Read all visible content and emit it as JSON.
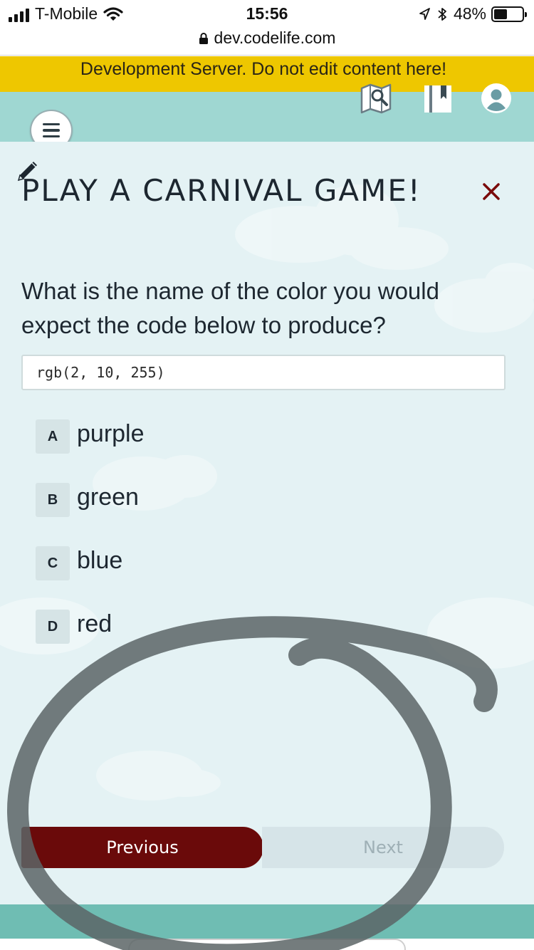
{
  "status_bar": {
    "carrier": "T-Mobile",
    "time": "15:56",
    "battery_percent": "48%",
    "battery_level": 0.48,
    "url": "dev.codelife.com"
  },
  "dev_banner": {
    "text": "Development Server. Do not edit content here!"
  },
  "header": {
    "icons": [
      "map-icon",
      "book-icon",
      "user-icon"
    ],
    "menu_icon": "hamburger-menu-icon"
  },
  "page": {
    "title": "PLAY A CARNIVAL GAME!",
    "close_symbol": "✕",
    "question": "What is the name of the color you would expect the code below to produce?",
    "code": "rgb(2, 10, 255)",
    "options": [
      {
        "letter": "A",
        "text": "purple"
      },
      {
        "letter": "B",
        "text": "green"
      },
      {
        "letter": "C",
        "text": "blue"
      },
      {
        "letter": "D",
        "text": "red"
      }
    ],
    "previous_label": "Previous",
    "next_label": "Next"
  },
  "colors": {
    "banner": "#eec700",
    "header": "#9fd7d2",
    "content_bg": "#e4f2f4",
    "previous_button": "#6a0a0a",
    "close_icon": "#7a0a0a",
    "footer": "#6fbdb3"
  }
}
